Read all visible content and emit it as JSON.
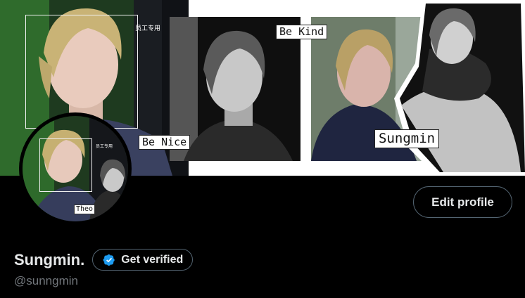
{
  "banner": {
    "tags": {
      "be_nice": "Be Nice",
      "be_kind": "Be Kind",
      "sungmin": "Sungmin"
    },
    "sign_text": "员工专用"
  },
  "avatar": {
    "tag": "Theo",
    "sign_text": "员工专用"
  },
  "profile": {
    "edit_label": "Edit profile",
    "display_name": "Sungmin.",
    "verify_label": "Get verified",
    "handle": "@sunngmin"
  },
  "colors": {
    "background": "#000000",
    "text_primary": "#e7e9ea",
    "text_secondary": "#71767b",
    "button_border": "#536471",
    "verified_blue": "#1d9bf0"
  }
}
